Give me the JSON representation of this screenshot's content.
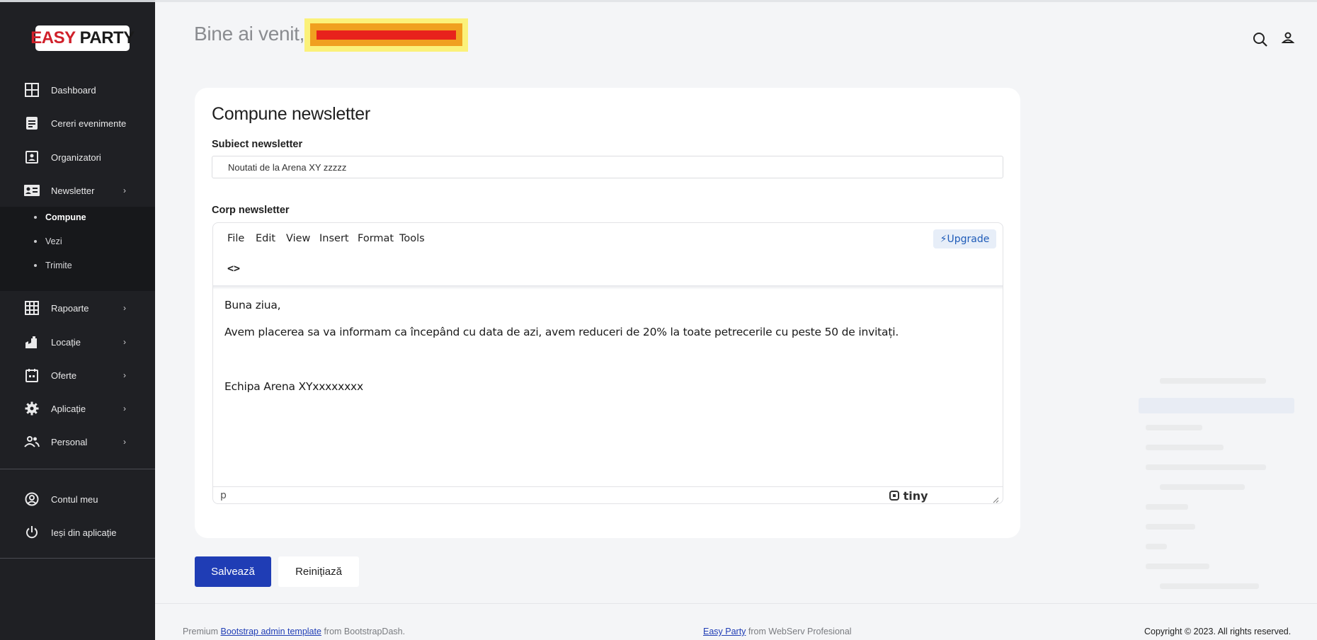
{
  "brand": {
    "logo_part1": "EASY",
    "logo_part2": "PARTY"
  },
  "sidebar": {
    "items": [
      {
        "label": "Dashboard",
        "icon": "dashboard-icon"
      },
      {
        "label": "Cereri evenimente",
        "icon": "document-icon"
      },
      {
        "label": "Organizatori",
        "icon": "contact-icon"
      },
      {
        "label": "Newsletter",
        "icon": "id-card-icon",
        "expanded": true
      },
      {
        "label": "Rapoarte",
        "icon": "grid-icon"
      },
      {
        "label": "Locație",
        "icon": "castle-icon"
      },
      {
        "label": "Oferte",
        "icon": "calendar-icon"
      },
      {
        "label": "Aplicație",
        "icon": "gear-icon"
      },
      {
        "label": "Personal",
        "icon": "people-icon"
      }
    ],
    "newsletter_sub": [
      {
        "label": "Compune",
        "active": true
      },
      {
        "label": "Vezi"
      },
      {
        "label": "Trimite"
      }
    ],
    "bottom": [
      {
        "label": "Contul meu",
        "icon": "account-icon"
      },
      {
        "label": "Ieși din aplicație",
        "icon": "power-icon"
      }
    ]
  },
  "header": {
    "welcome": "Bine ai venit,",
    "icons": [
      "search-icon",
      "user-icon"
    ]
  },
  "card": {
    "title": "Compune newsletter",
    "subject_label": "Subiect newsletter",
    "subject_value": "Noutati de la Arena XY zzzzz",
    "body_label": "Corp newsletter"
  },
  "editor": {
    "menu": [
      "File",
      "Edit",
      "View",
      "Insert",
      "Format",
      "Tools"
    ],
    "upgrade_label": "⚡Upgrade",
    "code_label": "<>",
    "content": [
      "Buna ziua,",
      "Avem placerea sa va informam ca începând cu data de azi, avem reduceri de 20% la toate petrecerile cu peste 50 de invitați.",
      "Echipa Arena XYxxxxxxxx"
    ],
    "status_path": "p",
    "brand": "tiny"
  },
  "actions": {
    "save": "Salvează",
    "reset": "Reinițiază"
  },
  "footer": {
    "left_pre": "Premium",
    "left_link": "Bootstrap admin template",
    "left_post": "from BootstrapDash.",
    "center_link": "Easy Party",
    "center_post": "from WebServ Profesional",
    "right": "Copyright © 2023. All rights reserved."
  },
  "colors": {
    "sidebar_bg": "#1f2024",
    "accent": "#1f3db5",
    "page_bg": "#f4f5f7"
  }
}
